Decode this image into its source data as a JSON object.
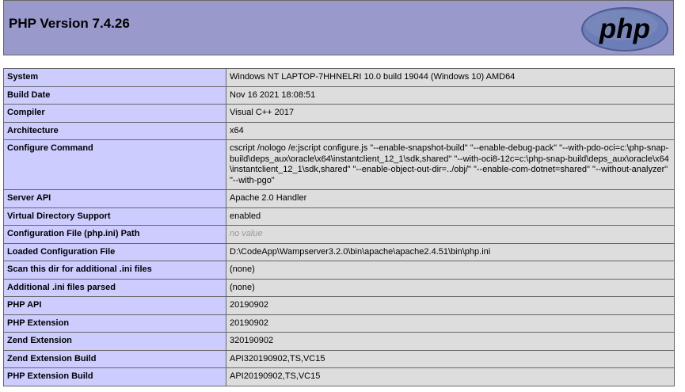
{
  "header": {
    "title": "PHP Version 7.4.26",
    "logo_text": "php"
  },
  "colors": {
    "header_bg": "#9999cc",
    "label_bg": "#ccccff",
    "value_bg": "#dddddd",
    "border": "#666666",
    "no_value": "#999999",
    "logo_fill": "#6c7eb7"
  },
  "rows": [
    {
      "label": "System",
      "value": "Windows NT LAPTOP-7HHNELRI 10.0 build 19044 (Windows 10) AMD64"
    },
    {
      "label": "Build Date",
      "value": "Nov 16 2021 18:08:51"
    },
    {
      "label": "Compiler",
      "value": "Visual C++ 2017"
    },
    {
      "label": "Architecture",
      "value": "x64"
    },
    {
      "label": "Configure Command",
      "value": "cscript /nologo /e:jscript configure.js \"--enable-snapshot-build\" \"--enable-debug-pack\" \"--with-pdo-oci=c:\\php-snap-build\\deps_aux\\oracle\\x64\\instantclient_12_1\\sdk,shared\" \"--with-oci8-12c=c:\\php-snap-build\\deps_aux\\oracle\\x64\\instantclient_12_1\\sdk,shared\" \"--enable-object-out-dir=../obj/\" \"--enable-com-dotnet=shared\" \"--without-analyzer\" \"--with-pgo\""
    },
    {
      "label": "Server API",
      "value": "Apache 2.0 Handler"
    },
    {
      "label": "Virtual Directory Support",
      "value": "enabled"
    },
    {
      "label": "Configuration File (php.ini) Path",
      "value": "no value"
    },
    {
      "label": "Loaded Configuration File",
      "value": "D:\\CodeApp\\Wampserver3.2.0\\bin\\apache\\apache2.4.51\\bin\\php.ini"
    },
    {
      "label": "Scan this dir for additional .ini files",
      "value": "(none)"
    },
    {
      "label": "Additional .ini files parsed",
      "value": "(none)"
    },
    {
      "label": "PHP API",
      "value": "20190902"
    },
    {
      "label": "PHP Extension",
      "value": "20190902"
    },
    {
      "label": "Zend Extension",
      "value": "320190902"
    },
    {
      "label": "Zend Extension Build",
      "value": "API320190902,TS,VC15"
    },
    {
      "label": "PHP Extension Build",
      "value": "API20190902,TS,VC15"
    }
  ]
}
